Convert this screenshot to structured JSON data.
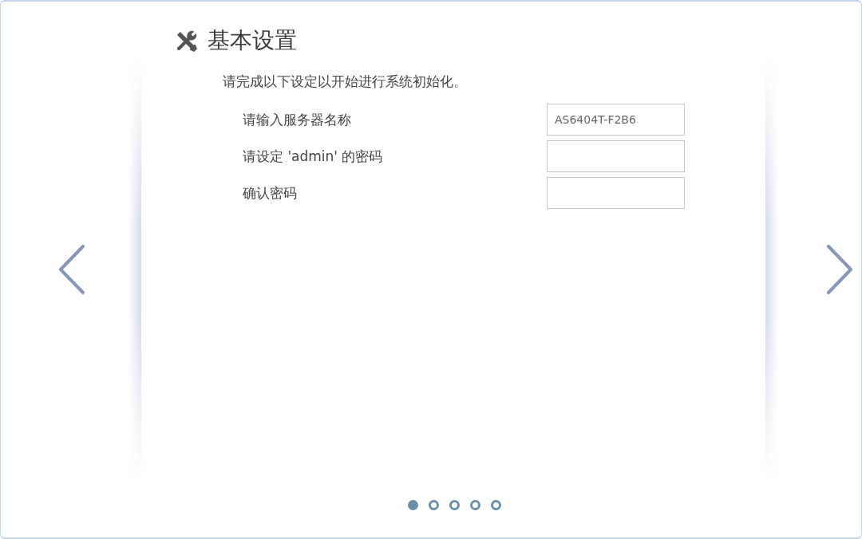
{
  "page": {
    "title": "基本设置",
    "instruction": "请完成以下设定以开始进行系统初始化。"
  },
  "fields": [
    {
      "label": "请输入服务器名称",
      "value": "AS6404T-F2B6"
    },
    {
      "label": "请设定 'admin' 的密码"
    },
    {
      "label": "确认密码"
    }
  ],
  "pager": [
    {
      "selected": true
    },
    {
      "selected": false
    },
    {
      "selected": false
    },
    {
      "selected": false
    },
    {
      "selected": false
    }
  ]
}
